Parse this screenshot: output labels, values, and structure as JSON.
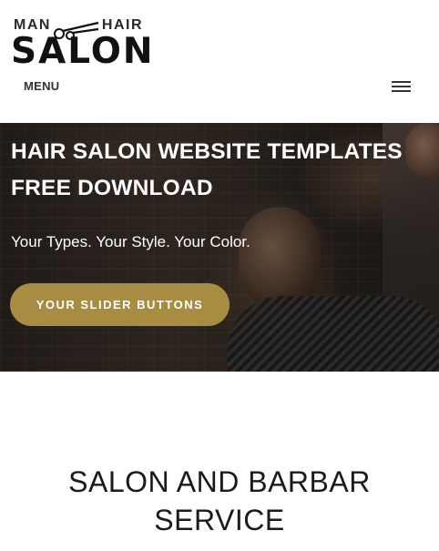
{
  "logo": {
    "top_left": "MAN",
    "top_right": "HAIR",
    "main": "SALON"
  },
  "nav": {
    "menu_label": "MENU"
  },
  "hero": {
    "title": "HAIR SALON WEBSITE TEMPLATES FREE DOWNLOAD",
    "subtitle": "Your Types. Your Style. Your Color.",
    "button_label": "YOUR SLIDER BUTTONS",
    "accent_color": "#a78c41"
  },
  "section": {
    "title_line1": "SALON AND BARBAR",
    "title_line2": "SERVICE"
  },
  "icons": {
    "logo_icon": "scissors-icon",
    "menu_icon": "hamburger-icon"
  }
}
